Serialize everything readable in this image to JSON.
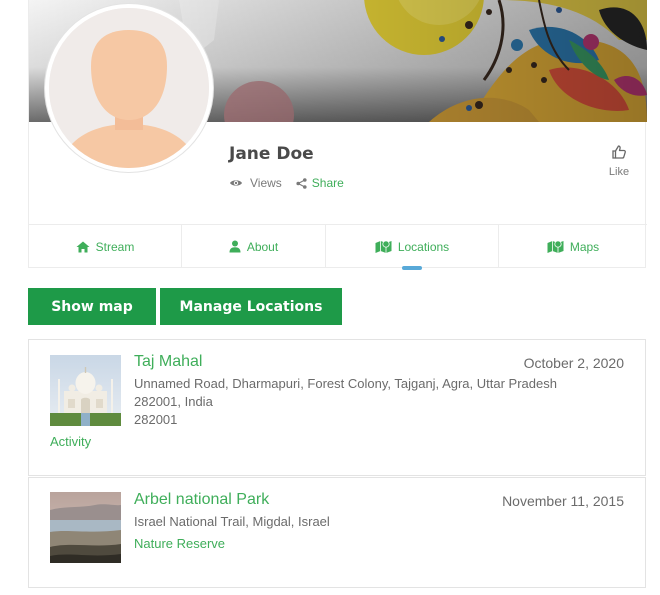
{
  "profile": {
    "name": "Jane Doe",
    "views_label": "Views",
    "share_label": "Share",
    "like_label": "Like"
  },
  "tabs": [
    {
      "label": "Stream",
      "icon": "home-icon",
      "active": false
    },
    {
      "label": "About",
      "icon": "user-icon",
      "active": false
    },
    {
      "label": "Locations",
      "icon": "map-icon",
      "active": true
    },
    {
      "label": "Maps",
      "icon": "map-icon",
      "active": false
    }
  ],
  "actions": {
    "show_map": "Show map",
    "manage_locations": "Manage Locations"
  },
  "locations": [
    {
      "title": "Taj Mahal",
      "date": "October 2, 2020",
      "address_line1": "Unnamed Road, Dharmapuri, Forest Colony, Tajganj, Agra, Uttar Pradesh",
      "address_line2": "282001, India",
      "postcode": "282001",
      "category": "Activity"
    },
    {
      "title": "Arbel national Park",
      "date": "November 11, 2015",
      "address_line1": "Israel National Trail, Migdal, Israel",
      "category": "Nature Reserve"
    }
  ],
  "colors": {
    "accent_green": "#3fae5a",
    "button_green": "#1e9a48",
    "tab_indicator": "#58a9d8"
  }
}
